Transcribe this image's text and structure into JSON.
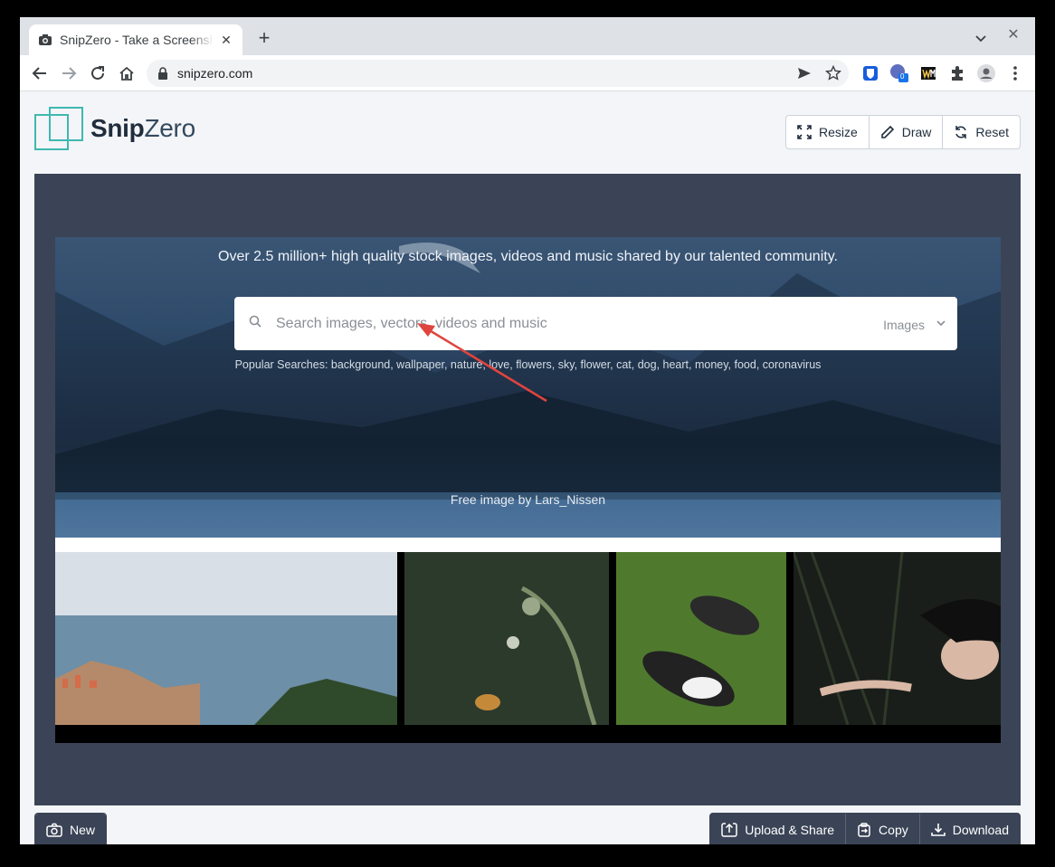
{
  "browser": {
    "tab_title": "SnipZero - Take a Screenshot",
    "url": "snipzero.com",
    "extension_badge": "0"
  },
  "app": {
    "logo_bold": "Snip",
    "logo_light": "Zero",
    "toolbar": {
      "resize": "Resize",
      "draw": "Draw",
      "reset": "Reset"
    },
    "footer": {
      "new": "New",
      "upload": "Upload & Share",
      "copy": "Copy",
      "download": "Download"
    }
  },
  "screenshot": {
    "hero_title": "Over 2.5 million+ high quality stock images, videos and music shared by our talented community.",
    "search_placeholder": "Search images, vectors, videos and music",
    "search_type": "Images",
    "popular": "Popular Searches: background, wallpaper, nature, love, flowers, sky, flower, cat, dog, heart, money, food, coronavirus",
    "credit": "Free image by Lars_Nissen"
  },
  "colors": {
    "canvas_bg": "#3b4456",
    "annotation_arrow": "#e0443e",
    "logo_accent": "#3fb8b0"
  }
}
